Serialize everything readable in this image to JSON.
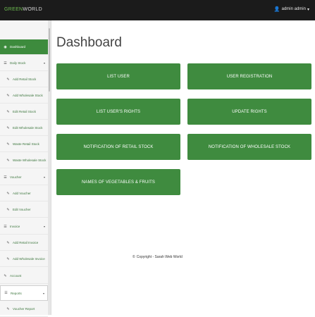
{
  "brand": {
    "part1": "GREEN",
    "part2": "WORLD"
  },
  "user_menu": {
    "label": "admin admin"
  },
  "sidebar": {
    "items": [
      {
        "label": "Dashboard"
      },
      {
        "label": "Daily Stock"
      },
      {
        "label": "Add Retail Stock"
      },
      {
        "label": "Add Wholesale Stock"
      },
      {
        "label": "Edit Retail Stock"
      },
      {
        "label": "Edit Wholesale Stock"
      },
      {
        "label": "Waste Retail Stock"
      },
      {
        "label": "Waste Wholesale Stock"
      },
      {
        "label": "Voucher"
      },
      {
        "label": "Add Voucher"
      },
      {
        "label": "Edit Voucher"
      },
      {
        "label": "Invoice"
      },
      {
        "label": "Add Retail Invoice"
      },
      {
        "label": "Add Wholesale Invoice"
      },
      {
        "label": "Account"
      },
      {
        "label": "Reports"
      },
      {
        "label": "Voucher Report"
      }
    ]
  },
  "main": {
    "title": "Dashboard",
    "tiles": [
      {
        "label": "List User"
      },
      {
        "label": "User Registration"
      },
      {
        "label": "List User's Rights"
      },
      {
        "label": "Update Rights"
      },
      {
        "label": "Notification of Retail Stock"
      },
      {
        "label": "Notification of Wholesale Stock"
      },
      {
        "label": "Names of Vegetables & Fruits"
      }
    ]
  },
  "footer": {
    "copyright": "Copyright - Sarah Web World"
  }
}
